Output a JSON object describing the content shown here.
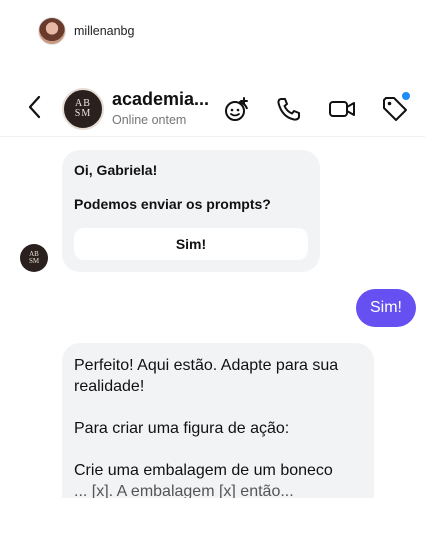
{
  "top_user": {
    "username": "millenanbg"
  },
  "header": {
    "title": "academia...",
    "status": "Online ontem",
    "avatar_initials_top": "AB",
    "avatar_initials_bottom": "SM",
    "notification_color": "#1d8cf8"
  },
  "icons": [
    "back-chevron-icon",
    "sticker-icon",
    "phone-icon",
    "video-camera-icon",
    "tag-icon"
  ],
  "messages": [
    {
      "from": "academia",
      "line1": "Oi, Gabriela!",
      "line2": "Podemos enviar os prompts?",
      "quick_reply": "Sim!"
    },
    {
      "from": "me",
      "text": "Sim!",
      "color": "#6650f2"
    },
    {
      "from": "academia",
      "p1": "Perfeito! Aqui estão. Adapte para sua realidade!",
      "p2": "Para criar uma figura de ação:",
      "p3": "Crie uma embalagem de um boneco",
      "p4_partial": "... [x]. A embalagem [x] então..."
    }
  ]
}
